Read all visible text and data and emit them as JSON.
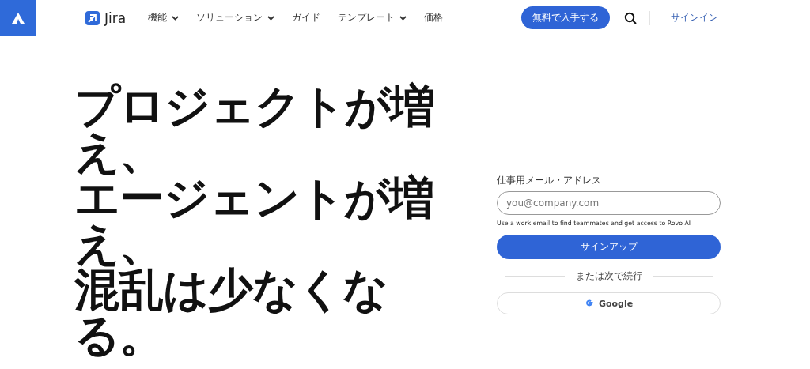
{
  "header": {
    "product": "Jira",
    "nav": [
      {
        "label": "機能",
        "has_menu": true
      },
      {
        "label": "ソリューション",
        "has_menu": true
      },
      {
        "label": "ガイド",
        "has_menu": false
      },
      {
        "label": "テンプレート",
        "has_menu": true
      },
      {
        "label": "価格",
        "has_menu": false
      }
    ],
    "cta": "無料で入手する",
    "signin": "サインイン"
  },
  "hero": {
    "headline_lines": [
      "プロジェクトが増",
      "え、",
      "エージェントが増",
      "え、",
      "混乱は少なくな",
      "る。"
    ]
  },
  "signup": {
    "email_label": "仕事用メール・アドレス",
    "email_placeholder": "you@company.com",
    "hint": "Use a work email to find teammates and get access to Rovo AI",
    "submit": "サインアップ",
    "divider": "または次で続行",
    "google": "Google"
  }
}
